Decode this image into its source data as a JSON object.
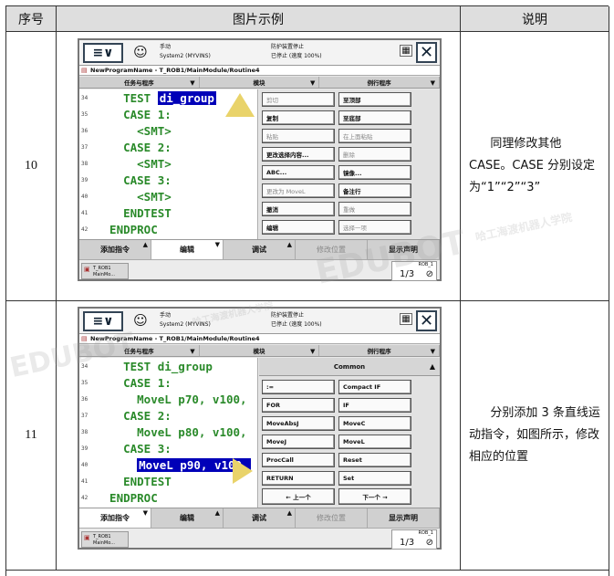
{
  "table": {
    "headers": [
      "序号",
      "图片示例",
      "说明"
    ],
    "rows": [
      {
        "number": "10",
        "description": "同理修改其他 CASE。CASE 分别设定为“1”“2”“3”"
      },
      {
        "number": "11",
        "description": "分别添加 3 条直线运动指令，如图所示，修改相应的位置"
      }
    ]
  },
  "pendant": {
    "mode": "手动",
    "system": "System2 (MYVINS)",
    "safety": "防护装置停止",
    "state": "已停止 (速度 100%)",
    "path": "NewProgramName - T_ROB1/MainModule/Routine4",
    "tabs": [
      "任务与程序",
      "模块",
      "例行程序"
    ],
    "bottom": [
      "添加指令",
      "编辑",
      "调试",
      "修改位置",
      "显示声明"
    ],
    "task_label": "T_ROB1 MainMo...",
    "rob_label": "ROB_1",
    "frac": "1/3"
  },
  "screen10": {
    "lines": [
      {
        "n": "34",
        "pre": "    TEST ",
        "sel": "di_group",
        "post": ""
      },
      {
        "n": "35",
        "pre": "    CASE 1:",
        "sel": "",
        "post": ""
      },
      {
        "n": "36",
        "pre": "      <SMT>",
        "sel": "",
        "post": ""
      },
      {
        "n": "37",
        "pre": "    CASE 2:",
        "sel": "",
        "post": ""
      },
      {
        "n": "38",
        "pre": "      <SMT>",
        "sel": "",
        "post": ""
      },
      {
        "n": "39",
        "pre": "    CASE 3:",
        "sel": "",
        "post": ""
      },
      {
        "n": "40",
        "pre": "      <SMT>",
        "sel": "",
        "post": ""
      },
      {
        "n": "41",
        "pre": "    ENDTEST",
        "sel": "",
        "post": ""
      },
      {
        "n": "42",
        "pre": "  ENDPROC",
        "sel": "",
        "post": ""
      }
    ],
    "edit_menu": [
      {
        "l": "剪切",
        "r": "至顶部",
        "ld": true,
        "rd": false
      },
      {
        "l": "复制",
        "r": "至底部",
        "ld": false,
        "rd": false
      },
      {
        "l": "粘贴",
        "r": "在上面粘贴",
        "ld": true,
        "rd": true
      },
      {
        "l": "更改选择内容...",
        "r": "删除",
        "ld": false,
        "rd": true
      },
      {
        "l": "ABC...",
        "r": "镜像...",
        "ld": false,
        "rd": false
      },
      {
        "l": "更改为 MoveL",
        "r": "备注行",
        "ld": true,
        "rd": false
      },
      {
        "l": "撤消",
        "r": "重做",
        "ld": false,
        "rd": true
      },
      {
        "l": "编辑",
        "r": "选择一项",
        "ld": false,
        "rd": true
      }
    ]
  },
  "screen11": {
    "lines": [
      {
        "n": "34",
        "pre": "    TEST di_group",
        "sel": "",
        "post": ""
      },
      {
        "n": "35",
        "pre": "    CASE 1:",
        "sel": "",
        "post": ""
      },
      {
        "n": "36",
        "pre": "      MoveL p70, v100,",
        "sel": "",
        "post": ""
      },
      {
        "n": "37",
        "pre": "    CASE 2:",
        "sel": "",
        "post": ""
      },
      {
        "n": "38",
        "pre": "      MoveL p80, v100,",
        "sel": "",
        "post": ""
      },
      {
        "n": "39",
        "pre": "    CASE 3:",
        "sel": "",
        "post": ""
      },
      {
        "n": "40",
        "pre": "      ",
        "sel": "MoveL p90, v100,",
        "post": ""
      },
      {
        "n": "41",
        "pre": "    ENDTEST",
        "sel": "",
        "post": ""
      },
      {
        "n": "42",
        "pre": "  ENDPROC",
        "sel": "",
        "post": ""
      }
    ],
    "pane_title": "Common",
    "instr": [
      [
        ":=",
        "Compact IF"
      ],
      [
        "FOR",
        "IF"
      ],
      [
        "MoveAbsJ",
        "MoveC"
      ],
      [
        "MoveJ",
        "MoveL"
      ],
      [
        "ProcCall",
        "Reset"
      ],
      [
        "RETURN",
        "Set"
      ]
    ],
    "prev": "←  上一个",
    "next": "下一个  →"
  },
  "watermark": {
    "brand": "EDUBOT",
    "academy": "哈工海渡机器人学院"
  }
}
